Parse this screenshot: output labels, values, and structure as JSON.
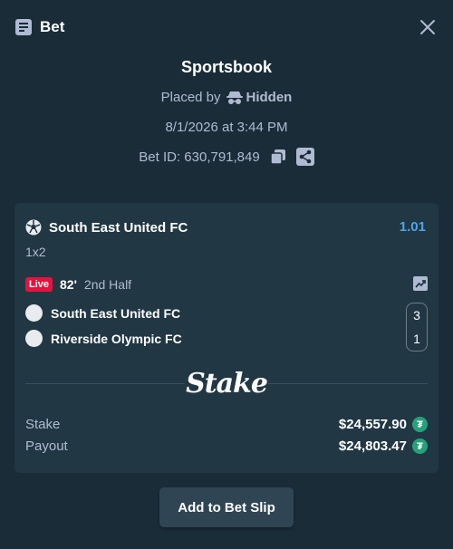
{
  "header": {
    "title": "Bet",
    "icon": "bet-slip-icon",
    "close_icon": "close-icon"
  },
  "meta": {
    "sportsbook": "Sportsbook",
    "placed_by_label": "Placed by",
    "placed_by_user": "Hidden",
    "date": "8/1/2026 at 3:44 PM",
    "bet_id_label": "Bet ID: 630,791,849"
  },
  "bet": {
    "selection": "South East United FC",
    "odds": "1.01",
    "market": "1x2",
    "live_badge": "Live",
    "minute": "82'",
    "period": "2nd Half",
    "teams": [
      {
        "name": "South East United FC",
        "score": "3"
      },
      {
        "name": "Riverside Olympic FC",
        "score": "1"
      }
    ],
    "brand": "Stake",
    "stake_label": "Stake",
    "stake_value": "$24,557.90",
    "payout_label": "Payout",
    "payout_value": "$24,803.47",
    "currency_icon": "usdt-icon"
  },
  "actions": {
    "add_to_slip": "Add to Bet Slip"
  },
  "colors": {
    "background": "#1a2c38",
    "card": "#213743",
    "odds": "#4fa3e8",
    "live": "#e9113c",
    "usdt": "#26a17b"
  }
}
